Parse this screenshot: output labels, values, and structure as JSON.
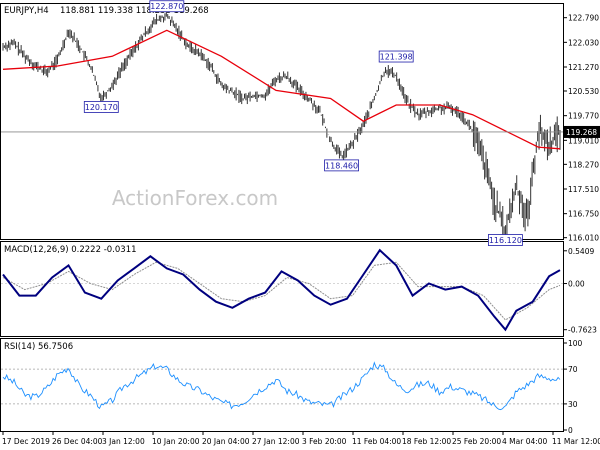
{
  "header": {
    "symbol_timeframe": "EURJPY,H4",
    "ohlc": "118.881 119.338 118.238 119.268"
  },
  "watermark": "ActionForex.com",
  "colors": {
    "bars": "#333333",
    "moving_average": "#e8000b",
    "macd_line": "#00007f",
    "macd_signal": "#8f8f8f",
    "rsi_line": "#1e90ff",
    "current_price_line": "#8a8a8a",
    "box_border": "#1d1ca8",
    "box_text": "#1d1ca8"
  },
  "chart_data": [
    {
      "type": "line",
      "name": "price",
      "title": "EURJPY,H4",
      "y_ticks": [
        "122.790",
        "122.030",
        "121.270",
        "120.530",
        "119.770",
        "119.010",
        "118.270",
        "117.510",
        "116.750",
        "116.010"
      ],
      "ylim": [
        116.0,
        123.15
      ],
      "current_price": "119.268",
      "x_labels": [
        "17 Dec 2019",
        "26 Dec 04:00",
        "3 Jan 12:00",
        "10 Jan 20:00",
        "20 Jan 04:00",
        "27 Jan 12:00",
        "3 Feb 20:00",
        "11 Feb 04:00",
        "18 Feb 12:00",
        "25 Feb 20:00",
        "4 Mar 04:00",
        "11 Mar 12:00"
      ],
      "close_path": [
        [
          0,
          121.9
        ],
        [
          2,
          122.0
        ],
        [
          4,
          121.6
        ],
        [
          6,
          121.3
        ],
        [
          8,
          121.1
        ],
        [
          10,
          121.5
        ],
        [
          12,
          122.4
        ],
        [
          14,
          121.9
        ],
        [
          16,
          121.3
        ],
        [
          18,
          120.3
        ],
        [
          20,
          120.7
        ],
        [
          22,
          121.3
        ],
        [
          24,
          121.8
        ],
        [
          26,
          122.3
        ],
        [
          28,
          122.7
        ],
        [
          30,
          122.85
        ],
        [
          32,
          122.4
        ],
        [
          34,
          121.9
        ],
        [
          36,
          121.7
        ],
        [
          38,
          121.3
        ],
        [
          40,
          120.7
        ],
        [
          42,
          120.5
        ],
        [
          44,
          120.3
        ],
        [
          46,
          120.4
        ],
        [
          48,
          120.4
        ],
        [
          50,
          120.9
        ],
        [
          52,
          121.0
        ],
        [
          54,
          120.6
        ],
        [
          56,
          120.3
        ],
        [
          58,
          119.9
        ],
        [
          60,
          119.0
        ],
        [
          62,
          118.5
        ],
        [
          64,
          118.9
        ],
        [
          66,
          119.5
        ],
        [
          68,
          120.3
        ],
        [
          70,
          121.2
        ],
        [
          72,
          121.0
        ],
        [
          74,
          120.2
        ],
        [
          76,
          119.8
        ],
        [
          78,
          119.9
        ],
        [
          80,
          120.0
        ],
        [
          82,
          120.0
        ],
        [
          84,
          119.8
        ],
        [
          86,
          119.3
        ],
        [
          88,
          118.4
        ],
        [
          90,
          117.1
        ],
        [
          92,
          116.2
        ],
        [
          94,
          117.6
        ],
        [
          96,
          116.6
        ],
        [
          98,
          119.3
        ],
        [
          100,
          118.9
        ],
        [
          102,
          119.268
        ]
      ],
      "moving_average": [
        [
          0,
          121.2
        ],
        [
          10,
          121.3
        ],
        [
          20,
          121.6
        ],
        [
          30,
          122.4
        ],
        [
          40,
          121.6
        ],
        [
          50,
          120.55
        ],
        [
          60,
          120.3
        ],
        [
          66,
          119.6
        ],
        [
          72,
          120.1
        ],
        [
          80,
          120.1
        ],
        [
          86,
          119.8
        ],
        [
          92,
          119.3
        ],
        [
          98,
          118.8
        ],
        [
          102,
          118.75
        ]
      ],
      "annotations": [
        {
          "x": 18,
          "y": 120.3,
          "label": "120.170",
          "anchor": "below"
        },
        {
          "x": 30,
          "y": 122.85,
          "label": "122.870",
          "anchor": "above"
        },
        {
          "x": 62,
          "y": 118.5,
          "label": "118.460",
          "anchor": "below"
        },
        {
          "x": 72,
          "y": 121.3,
          "label": "121.398",
          "anchor": "above"
        },
        {
          "x": 92,
          "y": 116.2,
          "label": "116.120",
          "anchor": "below"
        }
      ]
    },
    {
      "type": "line",
      "name": "macd",
      "title": "MACD(12,26,9) 0.2222 -0.0311",
      "y_ticks": [
        "0.5409",
        "0.00",
        "-0.7623"
      ],
      "ylim": [
        -0.85,
        0.62
      ],
      "macd_line": [
        [
          0,
          0.15
        ],
        [
          3,
          -0.2
        ],
        [
          6,
          -0.2
        ],
        [
          9,
          0.1
        ],
        [
          12,
          0.3
        ],
        [
          15,
          -0.15
        ],
        [
          18,
          -0.25
        ],
        [
          21,
          0.05
        ],
        [
          24,
          0.25
        ],
        [
          27,
          0.45
        ],
        [
          30,
          0.25
        ],
        [
          33,
          0.15
        ],
        [
          36,
          -0.1
        ],
        [
          39,
          -0.3
        ],
        [
          42,
          -0.4
        ],
        [
          45,
          -0.25
        ],
        [
          48,
          -0.15
        ],
        [
          51,
          0.2
        ],
        [
          54,
          0.05
        ],
        [
          57,
          -0.2
        ],
        [
          60,
          -0.35
        ],
        [
          63,
          -0.25
        ],
        [
          66,
          0.15
        ],
        [
          69,
          0.55
        ],
        [
          72,
          0.3
        ],
        [
          75,
          -0.2
        ],
        [
          78,
          0.0
        ],
        [
          81,
          -0.1
        ],
        [
          84,
          -0.05
        ],
        [
          87,
          -0.2
        ],
        [
          90,
          -0.55
        ],
        [
          92,
          -0.76
        ],
        [
          94,
          -0.45
        ],
        [
          97,
          -0.3
        ],
        [
          100,
          0.12
        ],
        [
          102,
          0.2222
        ]
      ],
      "signal_line": [
        [
          0,
          0.1
        ],
        [
          4,
          -0.1
        ],
        [
          8,
          0.0
        ],
        [
          12,
          0.2
        ],
        [
          16,
          0.0
        ],
        [
          20,
          -0.1
        ],
        [
          24,
          0.15
        ],
        [
          28,
          0.35
        ],
        [
          32,
          0.25
        ],
        [
          36,
          0.0
        ],
        [
          40,
          -0.25
        ],
        [
          44,
          -0.3
        ],
        [
          48,
          -0.2
        ],
        [
          52,
          0.1
        ],
        [
          56,
          0.0
        ],
        [
          60,
          -0.25
        ],
        [
          64,
          -0.2
        ],
        [
          68,
          0.3
        ],
        [
          72,
          0.35
        ],
        [
          76,
          -0.05
        ],
        [
          80,
          -0.05
        ],
        [
          84,
          -0.05
        ],
        [
          88,
          -0.2
        ],
        [
          92,
          -0.6
        ],
        [
          96,
          -0.4
        ],
        [
          100,
          -0.1
        ],
        [
          102,
          -0.0311
        ]
      ]
    },
    {
      "type": "line",
      "name": "rsi",
      "title": "RSI(14) 56.7506",
      "y_ticks": [
        "100",
        "70",
        "30",
        "0"
      ],
      "ylim": [
        0,
        100
      ],
      "levels": [
        70,
        30
      ],
      "values": [
        [
          0,
          62
        ],
        [
          2,
          55
        ],
        [
          4,
          40
        ],
        [
          6,
          38
        ],
        [
          8,
          48
        ],
        [
          10,
          64
        ],
        [
          12,
          72
        ],
        [
          14,
          50
        ],
        [
          16,
          40
        ],
        [
          18,
          26
        ],
        [
          20,
          34
        ],
        [
          22,
          50
        ],
        [
          24,
          58
        ],
        [
          26,
          66
        ],
        [
          28,
          74
        ],
        [
          30,
          70
        ],
        [
          32,
          58
        ],
        [
          34,
          50
        ],
        [
          36,
          46
        ],
        [
          38,
          38
        ],
        [
          40,
          32
        ],
        [
          42,
          28
        ],
        [
          44,
          32
        ],
        [
          46,
          42
        ],
        [
          48,
          50
        ],
        [
          50,
          58
        ],
        [
          52,
          45
        ],
        [
          54,
          40
        ],
        [
          56,
          32
        ],
        [
          58,
          30
        ],
        [
          60,
          28
        ],
        [
          62,
          38
        ],
        [
          64,
          48
        ],
        [
          66,
          60
        ],
        [
          68,
          76
        ],
        [
          70,
          70
        ],
        [
          72,
          52
        ],
        [
          74,
          46
        ],
        [
          76,
          52
        ],
        [
          78,
          54
        ],
        [
          80,
          44
        ],
        [
          82,
          50
        ],
        [
          84,
          46
        ],
        [
          86,
          42
        ],
        [
          88,
          36
        ],
        [
          90,
          28
        ],
        [
          92,
          26
        ],
        [
          94,
          44
        ],
        [
          96,
          52
        ],
        [
          98,
          62
        ],
        [
          100,
          60
        ],
        [
          102,
          56.75
        ]
      ]
    }
  ]
}
